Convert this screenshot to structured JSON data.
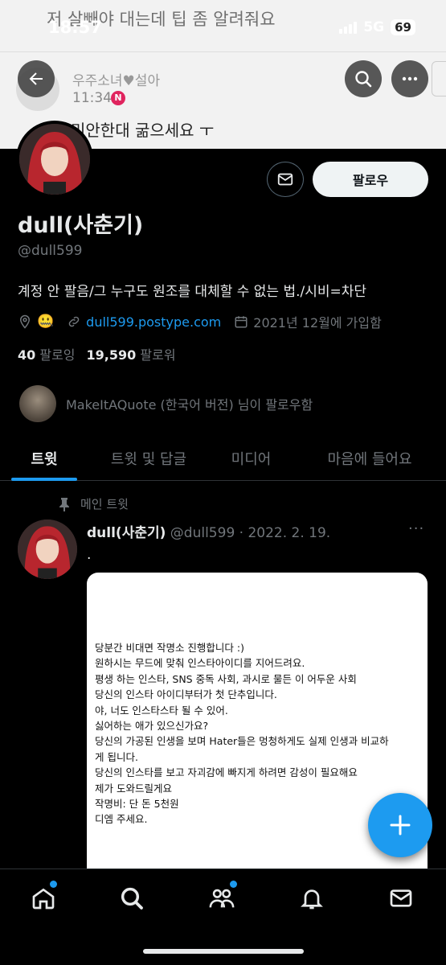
{
  "status_bar": {
    "time": "18:57",
    "network": "5G",
    "battery": "69"
  },
  "background_notification": {
    "top_text": "저 살빼야 대는데 팁 좀 알려줘요",
    "sender_name": "우주소녀♥설아",
    "time": "11:34",
    "badge": "N",
    "message": "미안한대 굶으세요 ㅜ"
  },
  "header": {
    "back_icon": "arrow-left-icon",
    "search_icon": "search-icon",
    "more_icon": "more-dots-icon"
  },
  "profile": {
    "display_name": "dull(사춘기)",
    "handle": "@dull599",
    "bio": "계정 안 팔음/그 누구도 원조를 대체할 수 없는 법./시비=차단",
    "location_emoji": "🤐",
    "link": "dull599.postype.com",
    "joined": "2021년 12월에 가입함",
    "following_count": "40",
    "following_label": "팔로잉",
    "followers_count": "19,590",
    "followers_label": "팔로워",
    "followed_by_text": "MakeItAQuote (한국어 버전) 님이 팔로우함",
    "follow_button": "팔로우"
  },
  "tabs": [
    {
      "label": "트윗",
      "active": true
    },
    {
      "label": "트윗 및 답글",
      "active": false
    },
    {
      "label": "미디어",
      "active": false
    },
    {
      "label": "마음에 들어요",
      "active": false
    }
  ],
  "pinned_tweet": {
    "pinned_label": "메인 트윗",
    "name": "dull(사춘기)",
    "handle_date": "@dull599 · 2022. 2. 19.",
    "more": "···",
    "text": ".",
    "card_lines": [
      "당분간 비대면 작명소 진행합니다 :)",
      "원하시는 무드에 맞춰 인스타아이디를 지어드려요.",
      "평생 하는 인스타, SNS 중독 사회, 과시로 물든 이 어두운 사회",
      "당신의 인스타 아이디부터가 첫 단추입니다.",
      "야, 너도 인스타스타 될 수 있어.",
      "싫어하는 애가 있으신가요?",
      "당신의 가공된 인생을 보며 Hater들은 멍청하게도 실제 인생과 비교하",
      "게 됩니다.",
      "당신의 인스타를 보고 자괴감에 빠지게 하려면 감성이 필요해요",
      "제가 도와드릴게요",
      "작명비: 단 돈 5천원",
      "디엠 주세요."
    ]
  },
  "bottom_nav": [
    "home-icon",
    "search-icon",
    "communities-icon",
    "notifications-icon",
    "messages-icon"
  ],
  "colors": {
    "accent": "#1d9bf0",
    "background": "#000000",
    "muted": "#71767b"
  }
}
